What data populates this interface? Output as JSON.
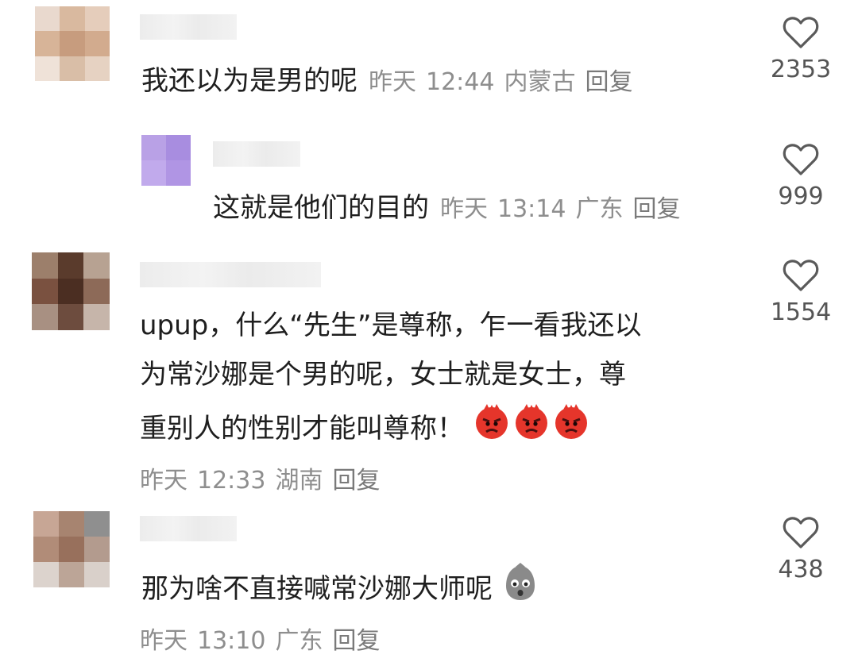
{
  "comments": [
    {
      "text": "我还以为是男的呢",
      "date": "昨天",
      "time": "12:44",
      "location": "内蒙古",
      "reply": "回复",
      "likes": "2353"
    },
    {
      "text": "这就是他们的目的",
      "date": "昨天",
      "time": "13:14",
      "location": "广东",
      "reply": "回复",
      "likes": "999"
    },
    {
      "lines": [
        "upup，什么“先生”是尊称，乍一看我还以",
        "为常沙娜是个男的呢，女士就是女士，尊",
        "重别人的性别才能叫尊称！"
      ],
      "date": "昨天",
      "time": "12:33",
      "location": "湖南",
      "reply": "回复",
      "likes": "1554"
    },
    {
      "text": "那为啥不直接喊常沙娜大师呢",
      "date": "昨天",
      "time": "13:10",
      "location": "广东",
      "reply": "回复",
      "likes": "438"
    }
  ],
  "icons": {
    "like": "heart-outline-icon",
    "angry": "angry-face-emoji",
    "speechless": "speechless-face-emoji"
  },
  "colors": {
    "meta": "#8e8e8e",
    "text": "#1f1f1f",
    "angry": "#e5352b",
    "speechless": "#8a8a8a"
  }
}
